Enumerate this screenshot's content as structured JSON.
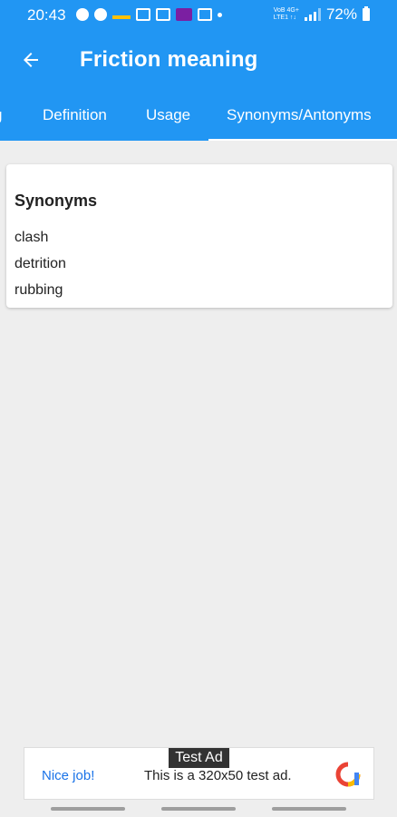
{
  "status_bar": {
    "time": "20:43",
    "network_line1": "VoB 4G+",
    "network_line2": "LTE1 ↑↓",
    "battery": "72%"
  },
  "app_bar": {
    "title": "Friction meaning",
    "back_icon": "arrow-left-icon"
  },
  "tabs": [
    {
      "label": "g",
      "active": false
    },
    {
      "label": "Definition",
      "active": false
    },
    {
      "label": "Usage",
      "active": false
    },
    {
      "label": "Synonyms/Antonyms",
      "active": true
    }
  ],
  "synonyms": {
    "heading": "Synonyms",
    "items": [
      "clash",
      "detrition",
      "rubbing"
    ]
  },
  "ad": {
    "label": "Test Ad",
    "nice": "Nice job!",
    "message": "This is a 320x50 test ad."
  },
  "colors": {
    "primary": "#2196f3",
    "background": "#eeeeee"
  }
}
